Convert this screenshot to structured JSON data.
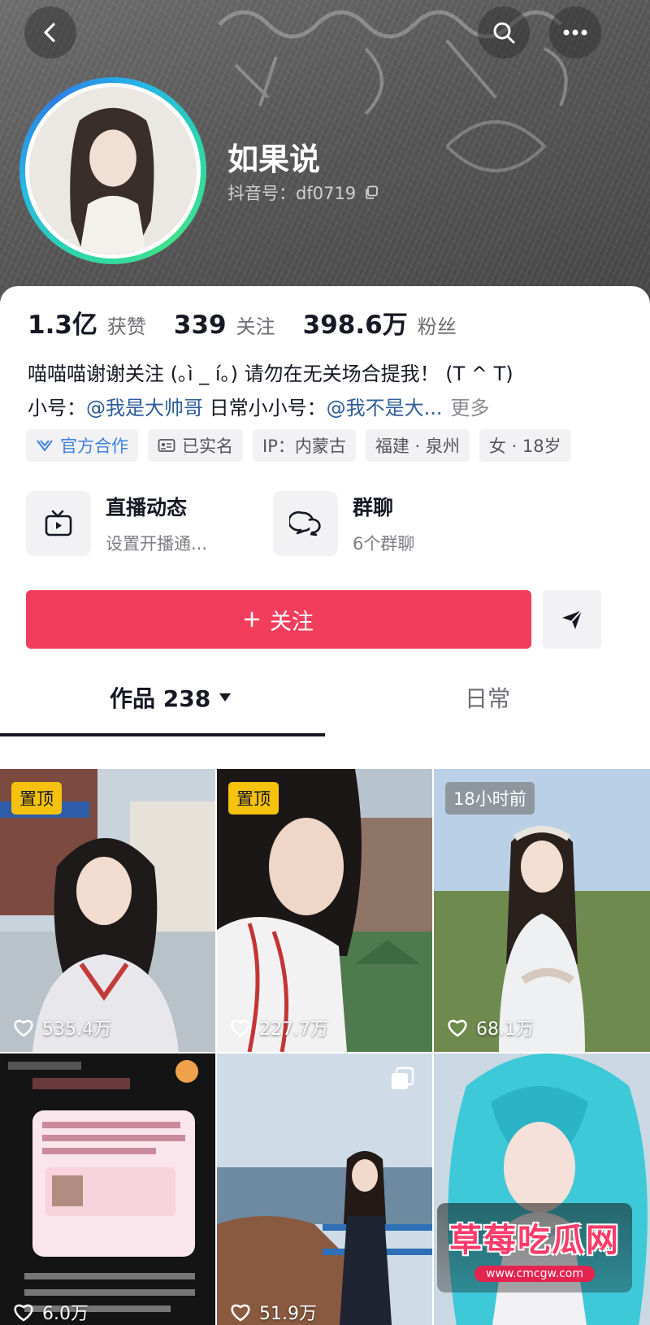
{
  "header": {
    "nickname": "如果说",
    "douyin_id_label": "抖音号：df0719",
    "icons": [
      "back-icon",
      "search-icon",
      "more-icon",
      "copy-icon"
    ]
  },
  "stats": [
    {
      "value": "1.3亿",
      "label": "获赞"
    },
    {
      "value": "339",
      "label": "关注"
    },
    {
      "value": "398.6万",
      "label": "粉丝"
    }
  ],
  "bio": {
    "line1": "喵喵喵谢谢关注 (｡ì _ í｡) 请勿在无关场合提我！ (T ^ T)",
    "line2_prefix": "小号：",
    "mention1": "@我是大帅哥",
    "line2_mid": " 日常小小号：",
    "mention2": "@我不是大...",
    "more": "更多"
  },
  "tags": [
    "官方合作",
    "已实名",
    "IP：内蒙古",
    "福建 · 泉州",
    "女 · 18岁"
  ],
  "features": [
    {
      "title": "直播动态",
      "subtitle": "设置开播通...",
      "icon": "tv-icon"
    },
    {
      "title": "群聊",
      "subtitle": "6个群聊",
      "icon": "group-chat-icon"
    }
  ],
  "actions": {
    "follow_label": "关注",
    "share_icon": "send-icon"
  },
  "tabs": {
    "works": "作品 238",
    "daily": "日常"
  },
  "videos": [
    {
      "badge": "置顶",
      "likes": "535.4万"
    },
    {
      "badge": "置顶",
      "likes": "227.7万"
    },
    {
      "badge": "18小时前",
      "likes": "68.1万"
    },
    {
      "badge": "",
      "likes": "6.0万"
    },
    {
      "badge": "",
      "likes": "51.9万"
    },
    {
      "badge": "",
      "likes": ""
    }
  ],
  "watermark": {
    "title": "草莓吃瓜网",
    "url": "www.cmcgw.com"
  },
  "colors": {
    "accent": "#f33d5c",
    "pin_badge": "#f5c20d",
    "mention": "#2f5c9a",
    "official": "#3d7fe0"
  }
}
